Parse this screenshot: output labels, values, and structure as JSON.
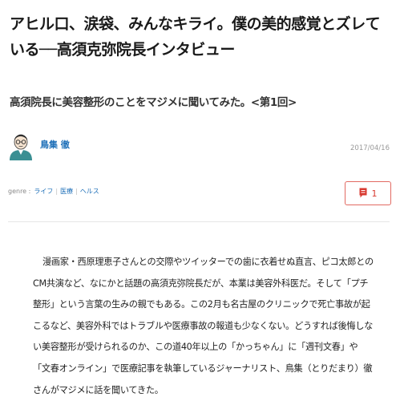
{
  "article": {
    "title": "アヒル口、涙袋、みんなキライ。僕の美的感覚とズレている──高須克弥院長インタビュー",
    "subtitle": "高須院長に美容整形のことをマジメに聞いてみた。<第1回>",
    "author": {
      "name": "鳥集 徹"
    },
    "date": "2017/04/16",
    "genre": {
      "label": "genre :",
      "tags": [
        "ライフ",
        "医療",
        "ヘルス"
      ]
    },
    "comments": {
      "count": "1",
      "icon": "comment-icon",
      "accent": "#d83a30"
    },
    "body": "漫画家・西原理恵子さんとの交際やツイッターでの歯に衣着せぬ直言、ピコ太郎とのCM共演など、なにかと話題の高須克弥院長だが、本業は美容外科医だ。そして「プチ整形」という言葉の生みの親でもある。この2月も名古屋のクリニックで死亡事故が起こるなど、美容外科ではトラブルや医療事故の報道も少なくない。どうすれば後悔しない美容整形が受けられるのか、この道40年以上の「かっちゃん」に「週刊文春」や「文春オンライン」で医療記事を執筆しているジャーナリスト、鳥集（とりだまり）徹さんがマジメに話を聞いてきた。"
  }
}
